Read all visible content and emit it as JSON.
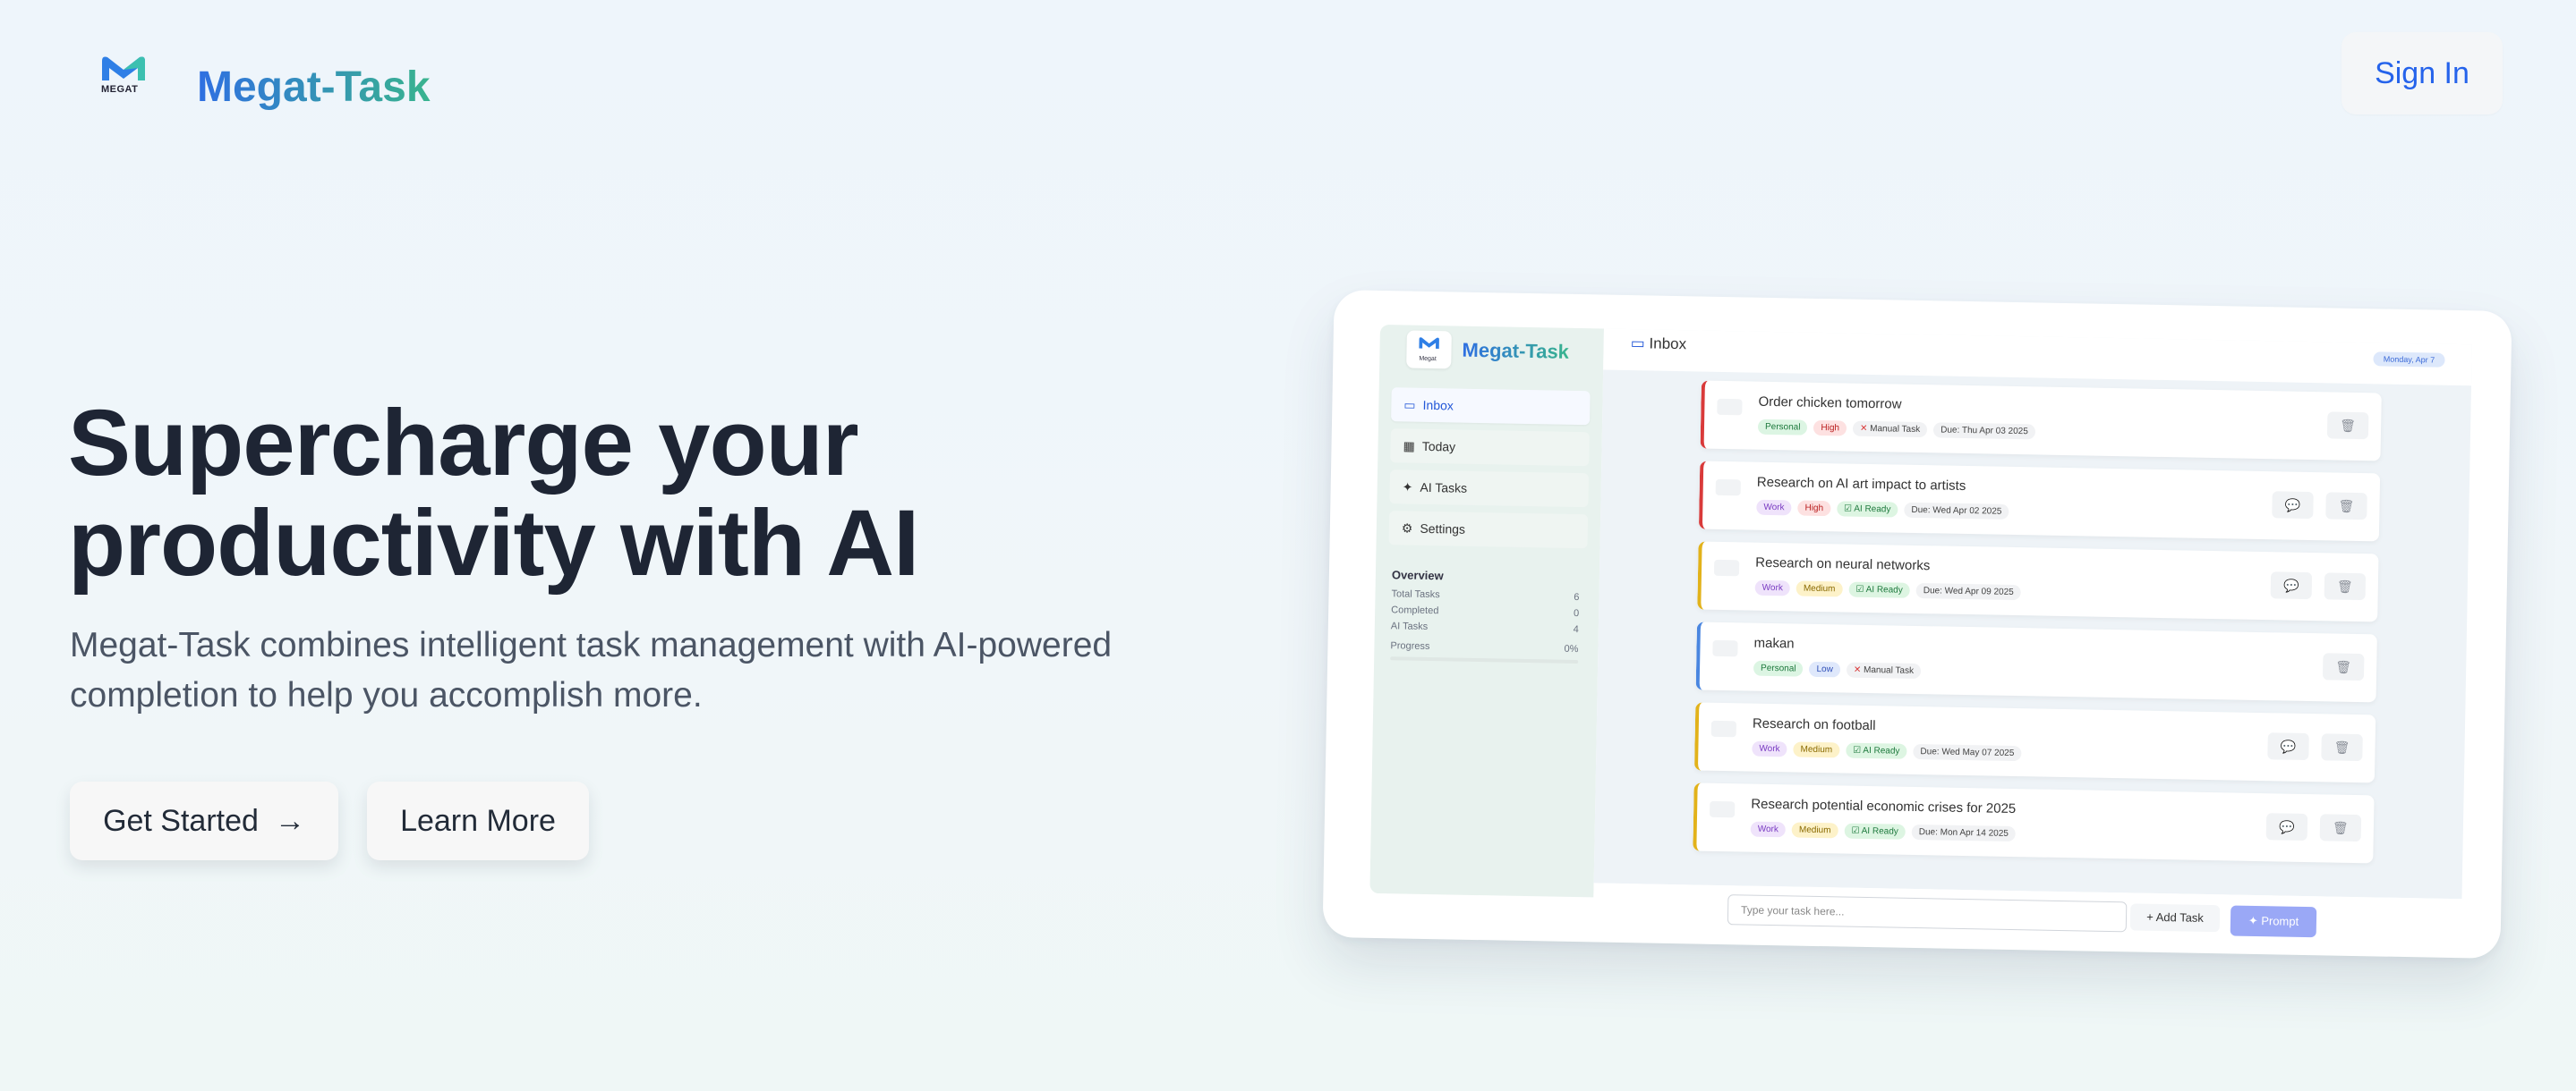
{
  "header": {
    "logo_text": "MEGAT",
    "brand": "Megat-Task",
    "sign_in_label": "Sign In"
  },
  "hero": {
    "title_line1": "Supercharge your",
    "title_line2": "productivity with AI",
    "subtitle": "Megat-Task combines intelligent task management with AI-powered completion to help you accomplish more.",
    "get_started_label": "Get Started",
    "learn_more_label": "Learn More"
  },
  "preview": {
    "brand": "Megat-Task",
    "logo_text": "Megat",
    "nav": [
      {
        "label": "Inbox",
        "icon": "inbox-icon"
      },
      {
        "label": "Today",
        "icon": "calendar-icon"
      },
      {
        "label": "AI Tasks",
        "icon": "sparkle-icon"
      },
      {
        "label": "Settings",
        "icon": "gear-icon"
      }
    ],
    "overview": {
      "title": "Overview",
      "rows": [
        {
          "label": "Total Tasks",
          "value": "6"
        },
        {
          "label": "Completed",
          "value": "0"
        },
        {
          "label": "AI Tasks",
          "value": "4"
        }
      ],
      "progress_label": "Progress",
      "progress_value": "0%"
    },
    "main_title": "Inbox",
    "date_pill": "Monday, Apr 7",
    "tasks": [
      {
        "title": "Order chicken tomorrow",
        "tags": [
          "Personal",
          "High",
          "Manual Task",
          "Due: Thu Apr 03 2025"
        ]
      },
      {
        "title": "Research on AI art impact to artists",
        "tags": [
          "Work",
          "High",
          "AI Ready",
          "Due: Wed Apr 02 2025"
        ]
      },
      {
        "title": "Research on neural networks",
        "tags": [
          "Work",
          "Medium",
          "AI Ready",
          "Due: Wed Apr 09 2025"
        ]
      },
      {
        "title": "makan",
        "tags": [
          "Personal",
          "Low",
          "Manual Task"
        ]
      },
      {
        "title": "Research on football",
        "tags": [
          "Work",
          "Medium",
          "AI Ready",
          "Due: Wed May 07 2025"
        ]
      },
      {
        "title": "Research potential economic crises for 2025",
        "tags": [
          "Work",
          "Medium",
          "AI Ready",
          "Due: Mon Apr 14 2025"
        ]
      }
    ],
    "input_placeholder": "Type your task here...",
    "add_task_label": "+ Add Task",
    "prompt_label": "Prompt"
  },
  "colors": {
    "brand_blue": "#2f6fe2",
    "brand_green": "#39b48e",
    "high": "#d93a3a",
    "medium": "#e2b21a",
    "low": "#4a86e0"
  }
}
